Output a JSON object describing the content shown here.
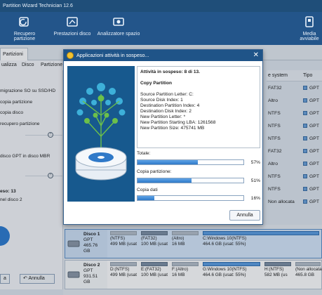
{
  "app": {
    "title": "Partition Wizard Technician 12.6"
  },
  "ribbon": {
    "recover_label": "Recupero partizione",
    "benchmark_label": "Prestazioni disco",
    "space_label": "Analizzatore spazio",
    "media_label": "Media avviabile"
  },
  "tabs": {
    "partitions": "Partizioni"
  },
  "menu": {
    "view": "ualizza",
    "disk": "Disco",
    "partition": "Partizione"
  },
  "leftpanel": {
    "items": [
      "migrazione SO su SSD/HD",
      "copia partizione",
      "copia disco",
      "recupero partizione",
      "disco GPT in disco MBR",
      "eso: 13",
      "nel disco 2"
    ]
  },
  "table": {
    "header_fs": "e system",
    "header_type": "Tipo",
    "rows": [
      {
        "fs": "FAT32",
        "type": "GPT"
      },
      {
        "fs": "Altro",
        "type": "GPT"
      },
      {
        "fs": "NTFS",
        "type": "GPT"
      },
      {
        "fs": "NTFS",
        "type": "GPT"
      },
      {
        "fs": "NTFS",
        "type": "GPT"
      },
      {
        "fs": "FAT32",
        "type": "GPT"
      },
      {
        "fs": "Altro",
        "type": "GPT"
      },
      {
        "fs": "NTFS",
        "type": "GPT"
      },
      {
        "fs": "NTFS",
        "type": "GPT"
      },
      {
        "fs": "Non allocata",
        "type": "GPT"
      }
    ]
  },
  "disks": [
    {
      "name": "Disco 1",
      "scheme": "GPT",
      "size": "465.76 GB",
      "parts": [
        {
          "l1": "(NTFS)",
          "l2": "499 MB (usat"
        },
        {
          "l1": "(FAT32)",
          "l2": "100 MB (usat"
        },
        {
          "l1": "(Altro)",
          "l2": "16 MB"
        },
        {
          "l1": "C:Windows 10(NTFS)",
          "l2": "464.6 GB (usat: 55%)"
        }
      ]
    },
    {
      "name": "Disco 2",
      "scheme": "GPT",
      "size": "931.51 GB",
      "parts": [
        {
          "l1": "D:(NTFS)",
          "l2": "499 MB (usat"
        },
        {
          "l1": "E:(FAT32)",
          "l2": "100 MB (usat"
        },
        {
          "l1": "F:(Altro)",
          "l2": "16 MB"
        },
        {
          "l1": "G:Windows 10(NTFS)",
          "l2": "464.6 GB (usat: 55%)"
        },
        {
          "l1": "H:(NTFS)",
          "l2": "582 MB (us"
        },
        {
          "l1": "(Non allocata",
          "l2": "465.8 GB"
        }
      ]
    }
  ],
  "bottom": {
    "apply": "a",
    "undo": "Annulla"
  },
  "modal": {
    "title": "Applicazioni attività in sospeso...",
    "close": "✕",
    "pending": "Attività in sospeso: 8 di 13.",
    "op": "Copy Partition",
    "lines": [
      "Source Partition Letter: C:",
      "Source Disk Index: 1",
      "Destination Partition Index: 4",
      "Destination Disk Index: 2",
      "New Partition Letter: *",
      "New Partition Starting LBA: 1261568",
      "New Partition Size: 475741 MB"
    ],
    "progress": [
      {
        "label": "Totale:",
        "pct_text": "57%",
        "value": 0.57
      },
      {
        "label": "Copia partizione:",
        "pct_text": "51%",
        "value": 0.51
      },
      {
        "label": "Copia dati",
        "pct_text": "16%",
        "value": 0.16
      }
    ],
    "cancel": "Annulla"
  }
}
